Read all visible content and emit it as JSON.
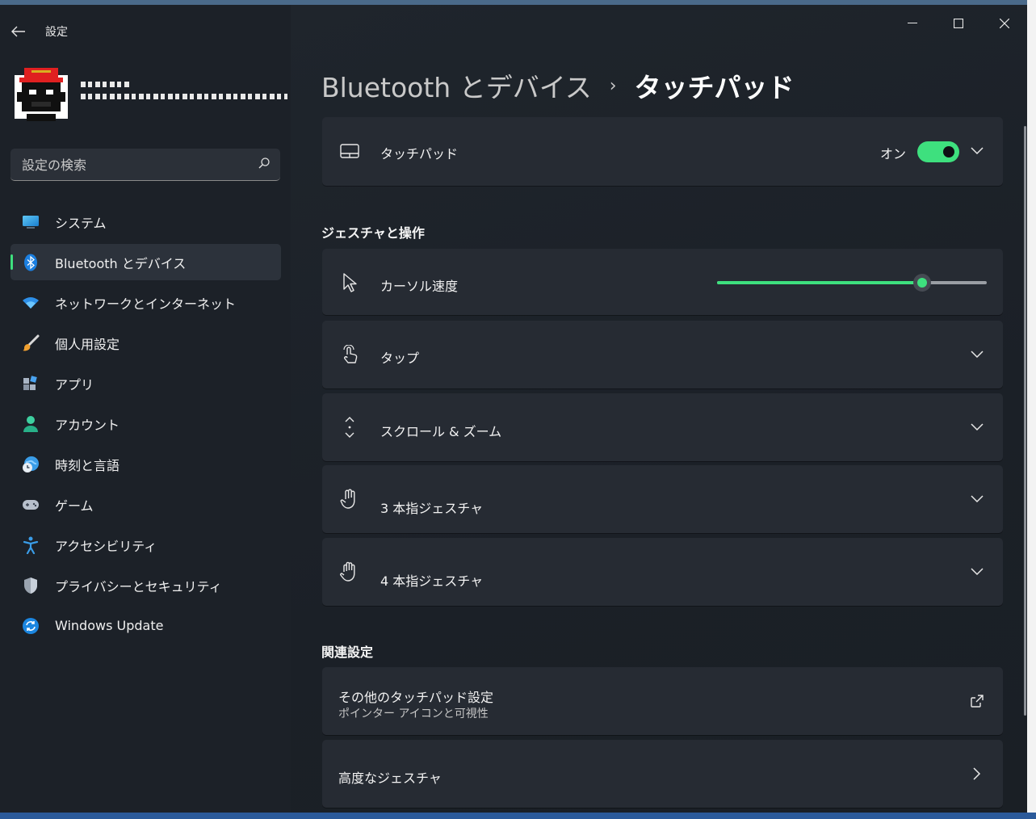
{
  "window": {
    "title": "設定"
  },
  "sidebar": {
    "search_placeholder": "設定の検索",
    "items": [
      {
        "label": "システム",
        "icon": "monitor-icon"
      },
      {
        "label": "Bluetooth とデバイス",
        "icon": "bluetooth-icon",
        "selected": true
      },
      {
        "label": "ネットワークとインターネット",
        "icon": "wifi-icon"
      },
      {
        "label": "個人用設定",
        "icon": "paintbrush-icon"
      },
      {
        "label": "アプリ",
        "icon": "apps-icon"
      },
      {
        "label": "アカウント",
        "icon": "person-icon"
      },
      {
        "label": "時刻と言語",
        "icon": "globe-clock-icon"
      },
      {
        "label": "ゲーム",
        "icon": "gamepad-icon"
      },
      {
        "label": "アクセシビリティ",
        "icon": "accessibility-icon"
      },
      {
        "label": "プライバシーとセキュリティ",
        "icon": "shield-icon"
      },
      {
        "label": "Windows Update",
        "icon": "sync-icon"
      }
    ]
  },
  "header": {
    "parent": "Bluetooth とデバイス",
    "separator": "›",
    "current": "タッチパッド"
  },
  "touchpad_card": {
    "label": "タッチパッド",
    "toggle_label": "オン",
    "toggle_on": true
  },
  "gestures": {
    "section_title": "ジェスチャと操作",
    "cursor_speed": {
      "label": "カーソル速度",
      "value_fraction": 0.76
    },
    "tap": {
      "label": "タップ"
    },
    "scroll_zoom": {
      "label": "スクロール & ズーム"
    },
    "three_finger": {
      "label": "3 本指ジェスチャ"
    },
    "four_finger": {
      "label": "4 本指ジェスチャ"
    }
  },
  "related": {
    "section_title": "関連設定",
    "more_touchpad": {
      "label": "その他のタッチパッド設定",
      "sublabel": "ポインター アイコンと可視性"
    },
    "advanced_gestures": {
      "label": "高度なジェスチャ"
    }
  },
  "colors": {
    "accent": "#3ee07e",
    "card": "#262b33",
    "window": "#1c2128"
  }
}
